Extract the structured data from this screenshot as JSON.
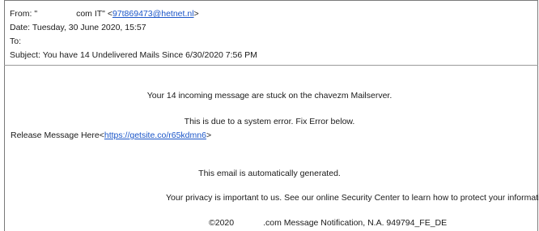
{
  "header": {
    "from_label": "From:",
    "from_prefix": "\"",
    "from_suffix": "com IT\"",
    "from_email_open": "<",
    "from_email": "97t869473@hetnet.nl",
    "from_email_close": ">",
    "date_label": "Date:",
    "date_value": "Tuesday, 30 June 2020, 15:57",
    "to_label": "To:",
    "subject_label": "Subject:",
    "subject_value": "You have 14 Undelivered Mails Since 6/30/2020 7:56 PM"
  },
  "body": {
    "stuck_text": "Your 14 incoming message are stuck on the chavezm Mailserver.",
    "error_text": "This is due to a system error. Fix Error below.",
    "release_label": "Release Message Here<",
    "release_link": "https://getsite.co/r65kdmn6",
    "release_close": ">",
    "auto_text": "This email is automatically generated.",
    "privacy_text": "Your privacy is important to us. See our online Security Center to learn how to protect your information.",
    "footer_copyright": "©2020",
    "footer_text": ".com Message Notification, N.A. 949794_FE_DE"
  },
  "colors": {
    "link": "#1a55c8",
    "text": "#1a1a1a",
    "border": "#7a7a7a"
  }
}
